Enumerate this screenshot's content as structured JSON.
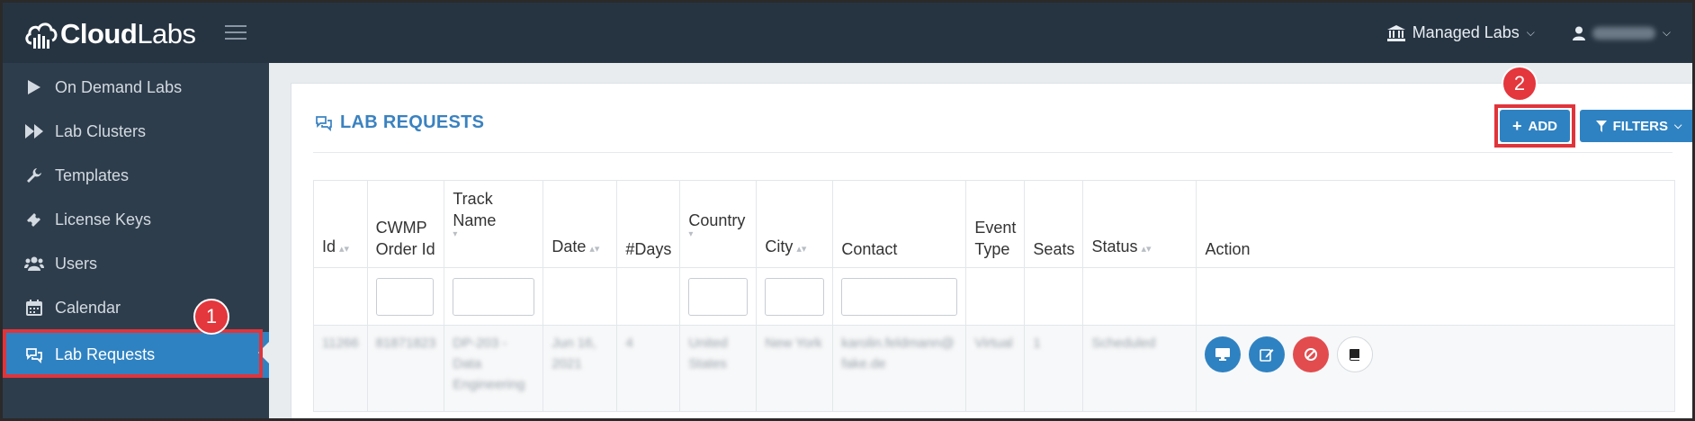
{
  "app": {
    "logo_bold": "Cloud",
    "logo_light": "Labs"
  },
  "topbar": {
    "managed_labs": "Managed Labs",
    "user_name": ""
  },
  "sidebar": {
    "items": [
      {
        "label": "On Demand Labs",
        "icon": "play-icon"
      },
      {
        "label": "Lab Clusters",
        "icon": "fast-forward-icon"
      },
      {
        "label": "Templates",
        "icon": "wrench-icon"
      },
      {
        "label": "License Keys",
        "icon": "ticket-icon"
      },
      {
        "label": "Users",
        "icon": "users-icon"
      },
      {
        "label": "Calendar",
        "icon": "calendar-icon"
      },
      {
        "label": "Lab Requests",
        "icon": "chat-icon",
        "active": true
      }
    ]
  },
  "page": {
    "title": "LAB REQUESTS",
    "add_label": "ADD",
    "filters_label": "FILTERS"
  },
  "annotations": {
    "badge_1": "1",
    "badge_2": "2"
  },
  "table": {
    "headers": {
      "id": "Id",
      "cwmp_line1": "CWMP",
      "cwmp_line2": "Order Id",
      "track_name": "Track Name",
      "date": "Date",
      "days": "#Days",
      "country": "Country",
      "city": "City",
      "contact": "Contact",
      "event_line1": "Event",
      "event_line2": "Type",
      "seats": "Seats",
      "status": "Status",
      "action": "Action"
    },
    "rows": [
      {
        "id": "11266",
        "order_id": "81871823",
        "track": "DP-203 - Data Engineering",
        "date": "Jun 16, 2021",
        "days": "4",
        "country": "United States",
        "city": "New York",
        "contact": "karolin.feldmann@fake.de",
        "event_type": "Virtual",
        "seats": "1",
        "status": "Scheduled"
      }
    ]
  },
  "colors": {
    "topbar": "#263442",
    "sidebar": "#2e3d4c",
    "accent": "#2f82c2",
    "highlight": "#e0343b"
  }
}
